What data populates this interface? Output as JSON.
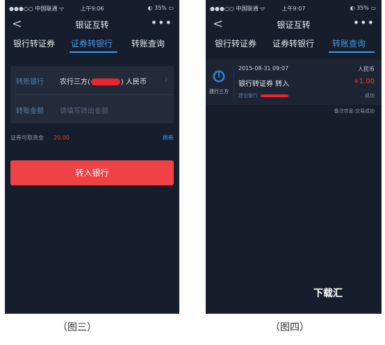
{
  "left": {
    "status": {
      "carrier": "●●●○○ 中国联通 ᯤ",
      "time": "上午9:06",
      "battery": "◐ 35% ▭"
    },
    "nav": {
      "back": "<",
      "title": "银证互转",
      "more": "•••"
    },
    "tabs": [
      "银行转证券",
      "证券转银行",
      "转账查询"
    ],
    "form": {
      "bank_label": "转账银行",
      "bank_value_prefix": "农行三方(",
      "bank_value_suffix": ") 人民币",
      "amount_label": "转账金额",
      "amount_placeholder": "请填写转出金额"
    },
    "available_label": "证券可取资金",
    "available_amount": "20.00",
    "refresh": "刷新",
    "submit_button": "转入银行",
    "caption": "（图三）"
  },
  "right": {
    "status": {
      "carrier": "●●●○○ 中国联通 ᯤ",
      "time": "上午9:07",
      "battery": "◐ 35% ▭"
    },
    "nav": {
      "back": "<",
      "title": "银证互转",
      "more": "•••"
    },
    "tabs": [
      "银行转证券",
      "证券转银行",
      "转账查询"
    ],
    "record": {
      "datetime": "2015-08-31 09:07",
      "currency": "人民币",
      "logo_label": "建行三方",
      "description": "银行转证券  转入",
      "amount": "+1.00",
      "sub_prefix": "建设银行",
      "status": "成功"
    },
    "remarks": "备注信息:交易成功",
    "caption": "（图四）"
  },
  "watermark": "下载汇",
  "colors": {
    "accent": "#3f9ae8",
    "danger": "#ef4246",
    "background": "#161d2d"
  }
}
